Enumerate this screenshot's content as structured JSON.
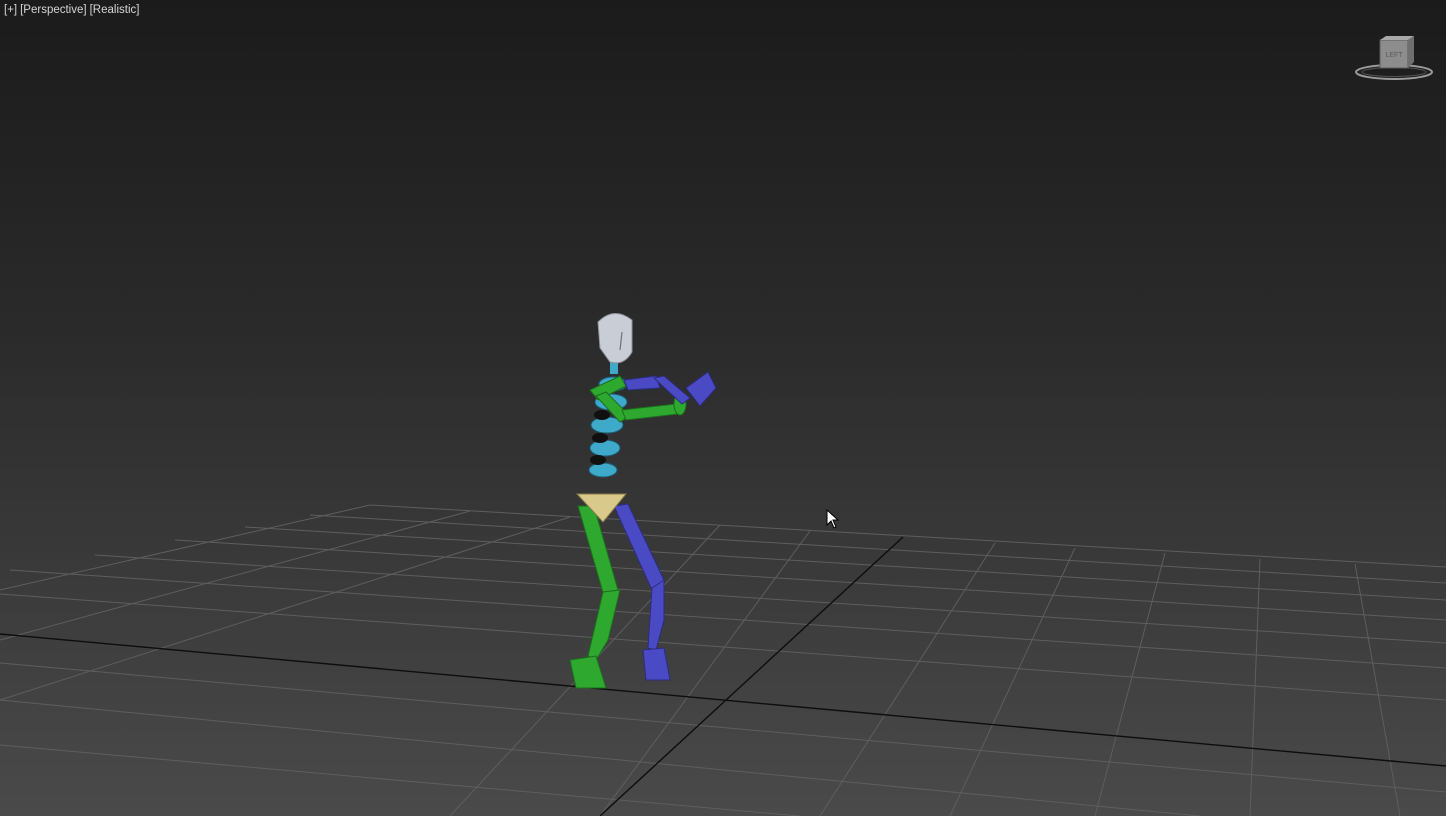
{
  "viewport": {
    "labels": {
      "plus_menu": "[+]",
      "view_name": "[Perspective]",
      "shading_mode": "[Realistic]"
    },
    "background_top": "#1b1b1b",
    "background_bottom": "#4a4a4a"
  },
  "viewcube": {
    "face_label": "LEFT",
    "icon": "viewcube-icon"
  },
  "scene": {
    "object": "biped-skeleton",
    "colors": {
      "head": "#c9ced6",
      "spine": "#3fa9c9",
      "left_limbs": "#2fa82f",
      "right_limbs": "#4a4ac4",
      "pelvis": "#d9c98a",
      "grid": "#6a6a6a",
      "grid_axis": "#0a0a0a"
    }
  },
  "cursor": {
    "icon": "mouse-pointer-icon"
  }
}
